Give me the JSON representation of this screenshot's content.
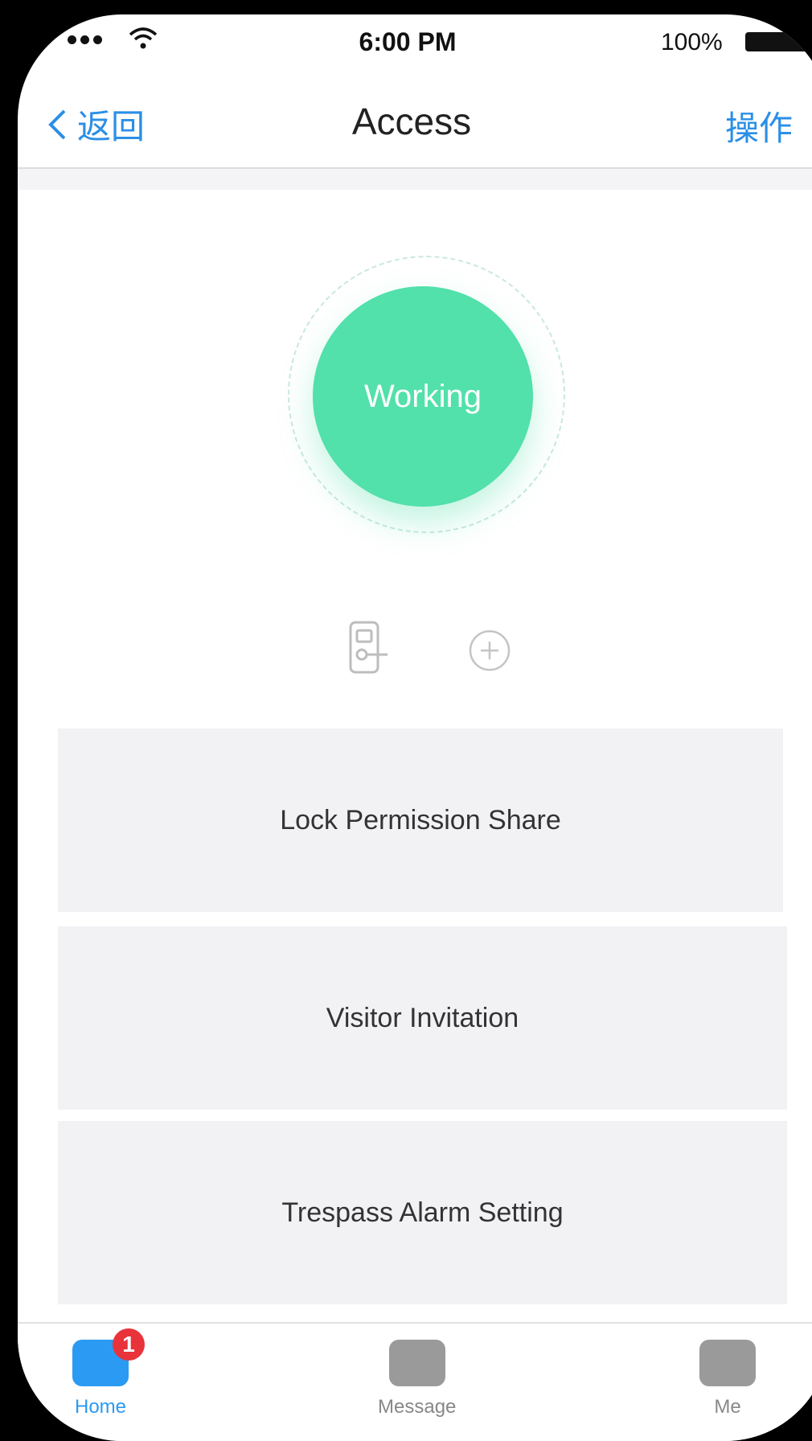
{
  "status_bar": {
    "time": "6:00 PM",
    "battery_percent": "100%"
  },
  "nav": {
    "back_label": "返回",
    "title": "Access",
    "action_label": "操作"
  },
  "device": {
    "status": "Working"
  },
  "cards": [
    {
      "label": "Lock Permission Share"
    },
    {
      "label": "Visitor Invitation"
    },
    {
      "label": "Trespass Alarm Setting"
    }
  ],
  "tabs": [
    {
      "label": "Home",
      "badge": "1",
      "icon": "home-icon"
    },
    {
      "label": "Message",
      "icon": "message-icon"
    },
    {
      "label": "Me",
      "icon": "me-icon"
    }
  ],
  "colors": {
    "accent": "#2b8fe6",
    "status_green": "#52e0ab",
    "badge_red": "#e8333b"
  }
}
